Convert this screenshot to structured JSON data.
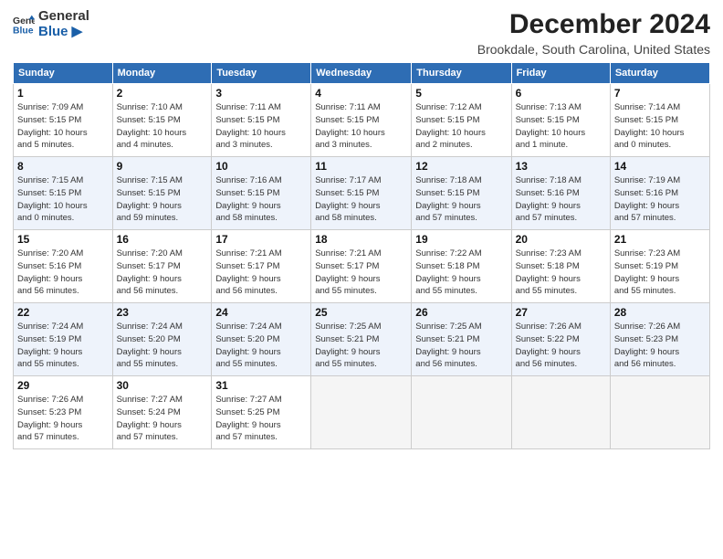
{
  "header": {
    "logo_line1": "General",
    "logo_line2": "Blue",
    "main_title": "December 2024",
    "subtitle": "Brookdale, South Carolina, United States"
  },
  "calendar": {
    "days_of_week": [
      "Sunday",
      "Monday",
      "Tuesday",
      "Wednesday",
      "Thursday",
      "Friday",
      "Saturday"
    ],
    "weeks": [
      [
        {
          "day": "",
          "empty": true
        },
        {
          "day": "",
          "empty": true
        },
        {
          "day": "",
          "empty": true
        },
        {
          "day": "",
          "empty": true
        },
        {
          "day": "5",
          "info": "Sunrise: 7:12 AM\nSunset: 5:15 PM\nDaylight: 10 hours\nand 2 minutes."
        },
        {
          "day": "6",
          "info": "Sunrise: 7:13 AM\nSunset: 5:15 PM\nDaylight: 10 hours\nand 1 minute."
        },
        {
          "day": "7",
          "info": "Sunrise: 7:14 AM\nSunset: 5:15 PM\nDaylight: 10 hours\nand 0 minutes."
        }
      ],
      [
        {
          "day": "1",
          "info": "Sunrise: 7:09 AM\nSunset: 5:15 PM\nDaylight: 10 hours\nand 5 minutes."
        },
        {
          "day": "2",
          "info": "Sunrise: 7:10 AM\nSunset: 5:15 PM\nDaylight: 10 hours\nand 4 minutes."
        },
        {
          "day": "3",
          "info": "Sunrise: 7:11 AM\nSunset: 5:15 PM\nDaylight: 10 hours\nand 3 minutes."
        },
        {
          "day": "4",
          "info": "Sunrise: 7:11 AM\nSunset: 5:15 PM\nDaylight: 10 hours\nand 3 minutes."
        },
        {
          "day": "5",
          "info": "Sunrise: 7:12 AM\nSunset: 5:15 PM\nDaylight: 10 hours\nand 2 minutes."
        },
        {
          "day": "6",
          "info": "Sunrise: 7:13 AM\nSunset: 5:15 PM\nDaylight: 10 hours\nand 1 minute."
        },
        {
          "day": "7",
          "info": "Sunrise: 7:14 AM\nSunset: 5:15 PM\nDaylight: 10 hours\nand 0 minutes."
        }
      ],
      [
        {
          "day": "8",
          "info": "Sunrise: 7:15 AM\nSunset: 5:15 PM\nDaylight: 10 hours\nand 0 minutes."
        },
        {
          "day": "9",
          "info": "Sunrise: 7:15 AM\nSunset: 5:15 PM\nDaylight: 9 hours\nand 59 minutes."
        },
        {
          "day": "10",
          "info": "Sunrise: 7:16 AM\nSunset: 5:15 PM\nDaylight: 9 hours\nand 58 minutes."
        },
        {
          "day": "11",
          "info": "Sunrise: 7:17 AM\nSunset: 5:15 PM\nDaylight: 9 hours\nand 58 minutes."
        },
        {
          "day": "12",
          "info": "Sunrise: 7:18 AM\nSunset: 5:15 PM\nDaylight: 9 hours\nand 57 minutes."
        },
        {
          "day": "13",
          "info": "Sunrise: 7:18 AM\nSunset: 5:16 PM\nDaylight: 9 hours\nand 57 minutes."
        },
        {
          "day": "14",
          "info": "Sunrise: 7:19 AM\nSunset: 5:16 PM\nDaylight: 9 hours\nand 57 minutes."
        }
      ],
      [
        {
          "day": "15",
          "info": "Sunrise: 7:20 AM\nSunset: 5:16 PM\nDaylight: 9 hours\nand 56 minutes."
        },
        {
          "day": "16",
          "info": "Sunrise: 7:20 AM\nSunset: 5:17 PM\nDaylight: 9 hours\nand 56 minutes."
        },
        {
          "day": "17",
          "info": "Sunrise: 7:21 AM\nSunset: 5:17 PM\nDaylight: 9 hours\nand 56 minutes."
        },
        {
          "day": "18",
          "info": "Sunrise: 7:21 AM\nSunset: 5:17 PM\nDaylight: 9 hours\nand 55 minutes."
        },
        {
          "day": "19",
          "info": "Sunrise: 7:22 AM\nSunset: 5:18 PM\nDaylight: 9 hours\nand 55 minutes."
        },
        {
          "day": "20",
          "info": "Sunrise: 7:23 AM\nSunset: 5:18 PM\nDaylight: 9 hours\nand 55 minutes."
        },
        {
          "day": "21",
          "info": "Sunrise: 7:23 AM\nSunset: 5:19 PM\nDaylight: 9 hours\nand 55 minutes."
        }
      ],
      [
        {
          "day": "22",
          "info": "Sunrise: 7:24 AM\nSunset: 5:19 PM\nDaylight: 9 hours\nand 55 minutes."
        },
        {
          "day": "23",
          "info": "Sunrise: 7:24 AM\nSunset: 5:20 PM\nDaylight: 9 hours\nand 55 minutes."
        },
        {
          "day": "24",
          "info": "Sunrise: 7:24 AM\nSunset: 5:20 PM\nDaylight: 9 hours\nand 55 minutes."
        },
        {
          "day": "25",
          "info": "Sunrise: 7:25 AM\nSunset: 5:21 PM\nDaylight: 9 hours\nand 55 minutes."
        },
        {
          "day": "26",
          "info": "Sunrise: 7:25 AM\nSunset: 5:21 PM\nDaylight: 9 hours\nand 56 minutes."
        },
        {
          "day": "27",
          "info": "Sunrise: 7:26 AM\nSunset: 5:22 PM\nDaylight: 9 hours\nand 56 minutes."
        },
        {
          "day": "28",
          "info": "Sunrise: 7:26 AM\nSunset: 5:23 PM\nDaylight: 9 hours\nand 56 minutes."
        }
      ],
      [
        {
          "day": "29",
          "info": "Sunrise: 7:26 AM\nSunset: 5:23 PM\nDaylight: 9 hours\nand 57 minutes."
        },
        {
          "day": "30",
          "info": "Sunrise: 7:27 AM\nSunset: 5:24 PM\nDaylight: 9 hours\nand 57 minutes."
        },
        {
          "day": "31",
          "info": "Sunrise: 7:27 AM\nSunset: 5:25 PM\nDaylight: 9 hours\nand 57 minutes."
        },
        {
          "day": "",
          "empty": true
        },
        {
          "day": "",
          "empty": true
        },
        {
          "day": "",
          "empty": true
        },
        {
          "day": "",
          "empty": true
        }
      ]
    ]
  }
}
